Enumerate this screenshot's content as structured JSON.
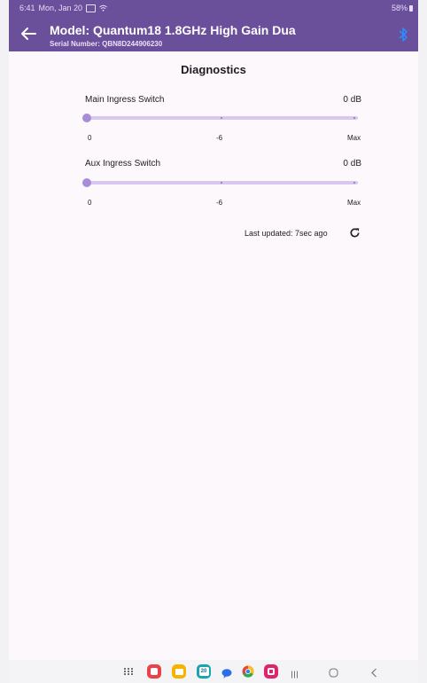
{
  "status_bar": {
    "time": "6:41",
    "date": "Mon, Jan 20",
    "battery": "58%"
  },
  "app_bar": {
    "title": "Model: Quantum18 1.8GHz  High Gain Dua",
    "subtitle": "Serial Number: QBN8D244906230"
  },
  "page": {
    "heading": "Diagnostics"
  },
  "sliders": [
    {
      "label": "Main Ingress Switch",
      "value": "0 dB",
      "ticks": [
        "0",
        "-6",
        "Max"
      ],
      "position": 0
    },
    {
      "label": "Aux Ingress Switch",
      "value": "0 dB",
      "ticks": [
        "0",
        "-6",
        "Max"
      ],
      "position": 0
    }
  ],
  "footer": {
    "last_updated": "Last updated: 7sec ago"
  },
  "nav": {
    "calendar_date": "20",
    "apps": [
      "apps-grid-icon",
      "notes-app-icon",
      "files-app-icon",
      "calendar-app-icon",
      "messages-app-icon",
      "chrome-app-icon",
      "screen-recorder-app-icon"
    ],
    "system": [
      "recents-icon",
      "home-icon",
      "back-nav-icon"
    ]
  },
  "colors": {
    "app_bar": "#6a4f9a",
    "accent": "#a98cd8",
    "track": "#d8c7ee",
    "bluetooth": "#2e8bff"
  }
}
